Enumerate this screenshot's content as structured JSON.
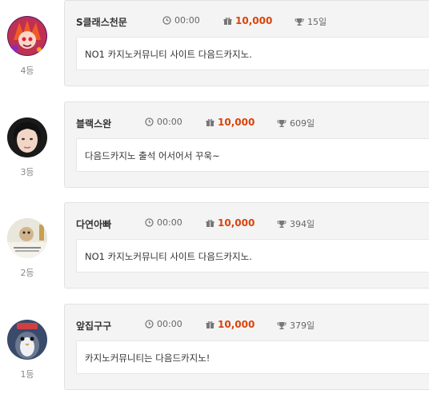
{
  "entries": [
    {
      "rank": "4등",
      "nickname": "S클래스천문",
      "time": "00:00",
      "points": "10,000",
      "days": "15일",
      "message": "NO1 카지노커뮤니티 사이트 다음드카지노."
    },
    {
      "rank": "3등",
      "nickname": "블랙스완",
      "time": "00:00",
      "points": "10,000",
      "days": "609일",
      "message": "다음드카지노 출석 어서어서 꾸욱~"
    },
    {
      "rank": "2등",
      "nickname": "다연아빠",
      "time": "00:00",
      "points": "10,000",
      "days": "394일",
      "message": "NO1 카지노커뮤니티 사이트 다음드카지노."
    },
    {
      "rank": "1등",
      "nickname": "앞집구구",
      "time": "00:00",
      "points": "10,000",
      "days": "379일",
      "message": "카지노커뮤니티는 다음드카지노!"
    }
  ],
  "icons": {
    "time": "clock-icon",
    "points": "gift-icon",
    "days": "trophy-icon"
  },
  "colors": {
    "points": "#d9430b",
    "card_bg": "#f4f4f4"
  }
}
